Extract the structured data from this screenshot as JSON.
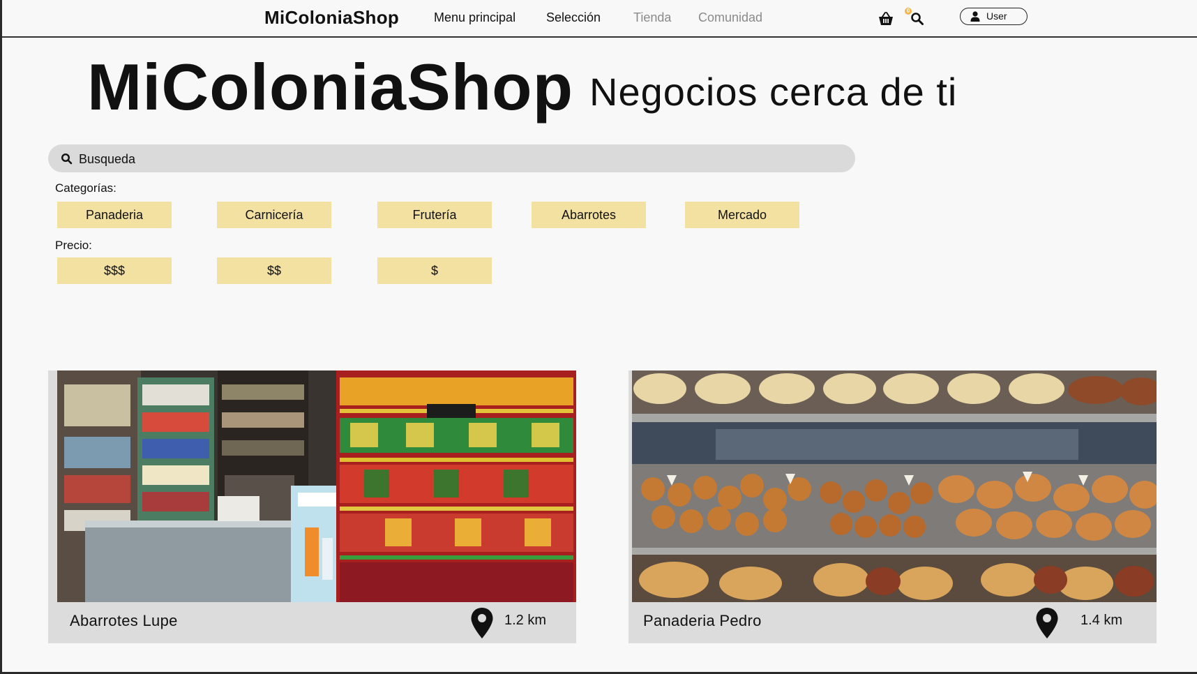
{
  "nav": {
    "logo": "MiColoniaShop",
    "links": [
      {
        "label": "Menu principal",
        "active": true
      },
      {
        "label": "Selección",
        "active": true
      },
      {
        "label": "Tienda",
        "active": false
      },
      {
        "label": "Comunidad",
        "active": false
      }
    ],
    "cart_count": "0",
    "cart_icon": "basket-icon",
    "search_icon": "search-icon",
    "user_label": "User"
  },
  "hero": {
    "title": "MiColoniaShop",
    "tagline": "Negocios cerca de ti"
  },
  "search": {
    "placeholder": "Busqueda"
  },
  "filters": {
    "categories_label": "Categorías:",
    "categories": [
      "Panaderia",
      "Carnicería",
      "Frutería",
      "Abarrotes",
      "Mercado"
    ],
    "price_label": "Precio:",
    "prices": [
      "$$$",
      "$$",
      "$"
    ]
  },
  "shops": [
    {
      "name": "Abarrotes Lupe",
      "distance": "1.2 km",
      "image": "grocery-store-photo"
    },
    {
      "name": "Panaderia Pedro",
      "distance": "1.4 km",
      "image": "bakery-photo"
    }
  ],
  "colors": {
    "chip": "#f3e1a2",
    "search_bg": "#dadada",
    "card_bg": "#dcdcdc",
    "badge": "#f1b54a",
    "muted_link": "#8a8a8a"
  }
}
